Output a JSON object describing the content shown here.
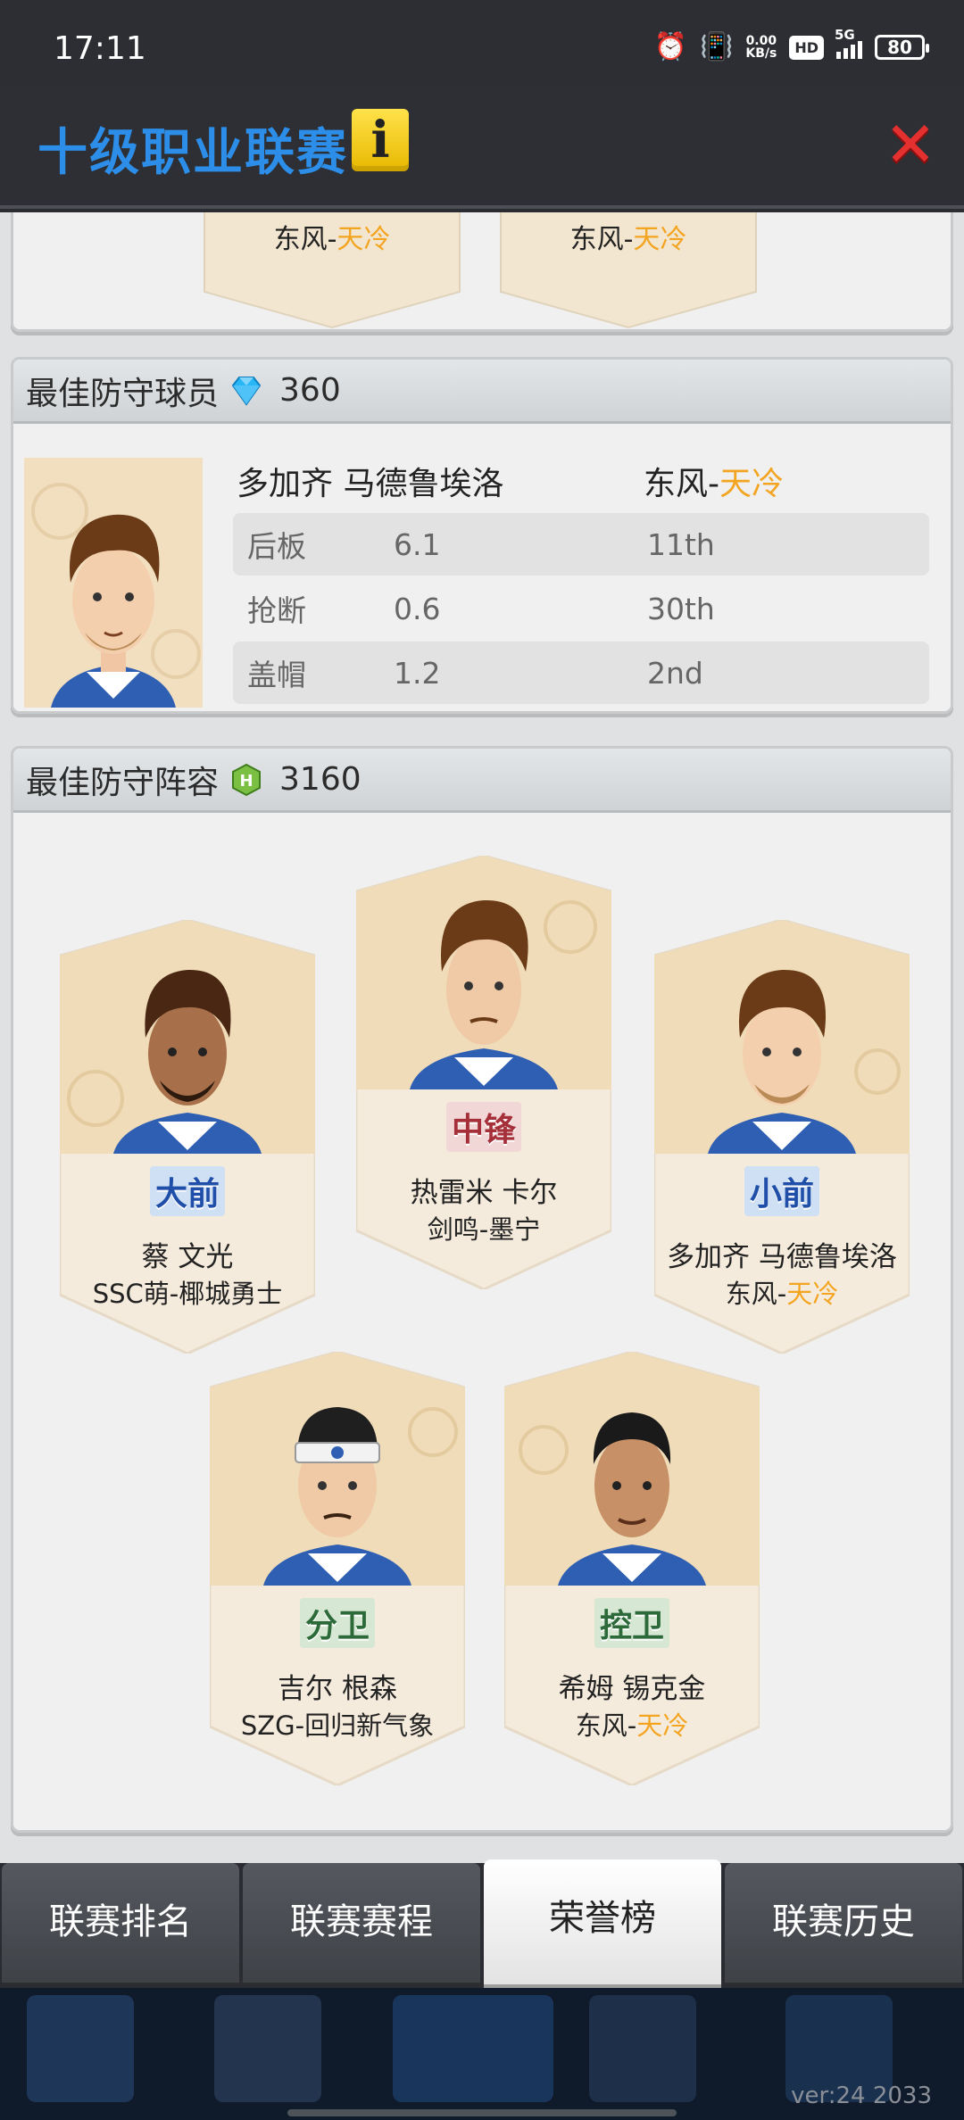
{
  "status_bar": {
    "time": "17:11",
    "net_speed": "0.00",
    "net_unit": "KB/s",
    "hd": "HD",
    "network": "5G",
    "battery": "80"
  },
  "header": {
    "title": "十级职业联赛",
    "info_label": "i"
  },
  "top_partial": {
    "card1_team": "东风-",
    "card1_team_accent": "天冷",
    "card2_team": "东风-",
    "card2_team_accent": "天冷"
  },
  "best_defender": {
    "title": "最佳防守球员",
    "reward": "360",
    "player_name": "多加齐 马德鲁埃洛",
    "team_prefix": "东风-",
    "team_accent": "天冷",
    "stats": [
      {
        "label": "后板",
        "value": "6.1",
        "rank": "11th"
      },
      {
        "label": "抢断",
        "value": "0.6",
        "rank": "30th"
      },
      {
        "label": "盖帽",
        "value": "1.2",
        "rank": "2nd"
      }
    ]
  },
  "best_defensive_lineup": {
    "title": "最佳防守阵容",
    "reward": "3160",
    "players": [
      {
        "position": "大前",
        "name": "蔡 文光",
        "team": "SSC萌-椰城勇士",
        "team_accent": ""
      },
      {
        "position": "中锋",
        "name": "热雷米 卡尔",
        "team": "剑鸣-墨宁",
        "team_accent": ""
      },
      {
        "position": "小前",
        "name": "多加齐 马德鲁埃洛",
        "team": "东风-",
        "team_accent": "天冷"
      },
      {
        "position": "分卫",
        "name": "吉尔 根森",
        "team": "SZG-回归新气象",
        "team_accent": ""
      },
      {
        "position": "控卫",
        "name": "希姆 锡克金",
        "team": "东风-",
        "team_accent": "天冷"
      }
    ]
  },
  "tabs": [
    {
      "label": "联赛排名"
    },
    {
      "label": "联赛赛程"
    },
    {
      "label": "荣誉榜"
    },
    {
      "label": "联赛历史"
    }
  ],
  "footer": {
    "version": "ver:24 2033"
  },
  "colors": {
    "accent_blue": "#2c8ee8",
    "team_orange": "#f3a522",
    "close_red": "#e53030",
    "info_yellow": "#f2c400"
  }
}
